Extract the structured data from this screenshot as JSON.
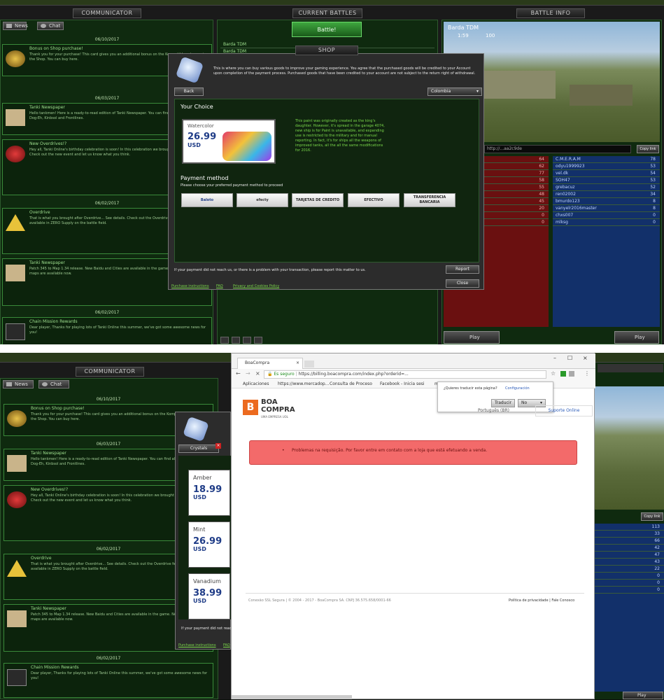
{
  "game": {
    "header_communicator": "COMMUNICATOR",
    "header_current_battles": "CURRENT BATTLES",
    "header_battle_info": "BATTLE INFO",
    "tab_news": "News",
    "tab_chat": "Chat",
    "battle_button": "Battle!",
    "shop_button": "SHOP",
    "battle_list": [
      "Barda TDM",
      "Barda TDM"
    ],
    "battle_info_title": "Barda TDM",
    "battle_info_count": "1:59",
    "battle_info_score": "100",
    "battle_url": "http://...aa2c9de",
    "copy_link": "Copy link",
    "play": "Play",
    "team_red_scores": [
      "64",
      "62",
      "77",
      "58",
      "55",
      "48",
      "45",
      "20",
      "0",
      "0"
    ],
    "team_blue": [
      {
        "name": "C.M.E.R.A.M",
        "score": "78"
      },
      {
        "name": "odyu1999923",
        "score": "53"
      },
      {
        "name": "vel.dk",
        "score": "54"
      },
      {
        "name": "SOH47",
        "score": "53"
      },
      {
        "name": "grebacuz",
        "score": "52"
      },
      {
        "name": "ren02002",
        "score": "34"
      },
      {
        "name": "bmurdo123",
        "score": "8"
      },
      {
        "name": "vanyelr2016master",
        "score": "8"
      },
      {
        "name": "chxs007",
        "score": "0"
      },
      {
        "name": "mlksg",
        "score": "0"
      }
    ],
    "team_blue_scores_lower": [
      "113",
      "33",
      "66",
      "42",
      "47",
      "43",
      "22",
      "0",
      "0",
      "0"
    ],
    "feed": [
      {
        "date": "06/10/2017",
        "title": "Bonus on Shop purchase!",
        "body": "Thank you for your purchase! This card gives you an additional bonus on the Kompatible category in the Shop. You can buy here.",
        "icon": "bonus-icon"
      },
      {
        "date": "06/03/2017",
        "title": "Tanki Newspaper",
        "body": "Hello tankmen! Here is a ready-to-read edition of Tanki Newspaper. You can find all new issues in Dog-Eh, Kinbsol and Frontlines.",
        "icon": "newspaper-icon"
      },
      {
        "date": "",
        "title": "New Overdrives!?",
        "body": "Hey all, Tanki Online's birthday celebration is soon! In this celebration we brought back overdrives. Check out the new event and let us know what you think.",
        "icon": "overdrive-icon"
      },
      {
        "date": "06/02/2017",
        "title": "Overdrive",
        "body": "That is what you brought after Overdrive... See details. Check out the Overdrive feature now available in ZERO Supply on the battle field.",
        "icon": "warning-icon"
      },
      {
        "date": "",
        "title": "Tanki Newspaper",
        "body": "Patch 345 to Map 1.34 release. New Baidu and Cities are available in the game. New elements in the maps are available now.",
        "icon": "newspaper-icon"
      },
      {
        "date": "06/02/2017",
        "title": "Chain Mission Rewards",
        "body": "Dear player, Thanks for playing lots of Tanki Online this summer, we've got some awesome news for you!",
        "icon": "mission-icon"
      }
    ]
  },
  "shop_dialog": {
    "notice": "This is where you can buy various goods to improve your gaming experience. You agree that the purchased goods will be credited to your Account upon completion of the payment process. Purchased goods that have been credited to your account are not subject to the return right of withdrawal.",
    "back": "Back",
    "country": "Colombia",
    "your_choice": "Your Choice",
    "item_name": "Watercolor",
    "item_price": "26.99",
    "item_currency": "USD",
    "item_desc": "This paint was originally created as the king's daughter. However, it's spread in the garage 4074, new ship is for Paint is unavailable, and expanding use is restricted to the military and for manual reporting. In fact, it's for ships all the weapons of improved tanks, all the all the same modifications for 2016.",
    "payment_method": "Payment method",
    "payment_hint": "Please choose your preferred payment method to proceed",
    "methods": [
      "Baloto",
      "efecty",
      "TARJETAS DE CREDITO",
      "EFECTIVO",
      "TRANSFERENCIA BANCARIA"
    ],
    "footer_notice": "If your payment did not reach us, or there is a problem with your transaction, please report this matter to us.",
    "report": "Report",
    "close": "Close",
    "links": [
      "Purchase instructions",
      "FAQ",
      "Privacy and Cookies Policy"
    ]
  },
  "shop_dialog_lower": {
    "tab_crystals": "Crystals",
    "items": [
      {
        "name": "Amber",
        "price": "18.99",
        "currency": "USD"
      },
      {
        "name": "Mint",
        "price": "26.99",
        "currency": "USD"
      },
      {
        "name": "Vanadium",
        "price": "38.99",
        "currency": "USD"
      }
    ],
    "footer_notice": "If your payment did not reach us",
    "link": "Purchase instructions",
    "link2": "FAQ"
  },
  "browser": {
    "tab_title": "BoaCompra",
    "secure_label": "Es seguro",
    "url": "https://billing.boacompra.com/index.php?orderid=...",
    "bookmarks": [
      "Aplicaciones",
      "https://www.mercadop...",
      "Consulta de Proceso",
      "Facebook - Inicia sesi",
      "m"
    ],
    "translate_q": "¿Quieres traducir esta página?",
    "translate_btn": "Traducir",
    "translate_no": "No",
    "translate_config": "Configuración",
    "logo_line1": "BOA",
    "logo_line2": "COMPRA",
    "logo_sub": "UMA EMPRESA UOL",
    "support_link": "Suporte Online",
    "lang": "Português (BR)",
    "error": "Problemas na requisição. Por favor entre em contato com a loja que está efetuando a venda.",
    "footer_left": "Conexão SSL Segura | © 2004 - 2017 - BoaCompra SA. CNPJ 36.575.658/0001-66",
    "footer_right": "Política de privacidade | Fale Conosco"
  },
  "colors": {
    "panel_green": "#0f2a0f",
    "border_green": "#3a8a3a",
    "team_red": "#7a1414",
    "team_blue": "#15357a",
    "error_bg": "#f36a6a",
    "logo_orange": "#ec6a1f"
  }
}
